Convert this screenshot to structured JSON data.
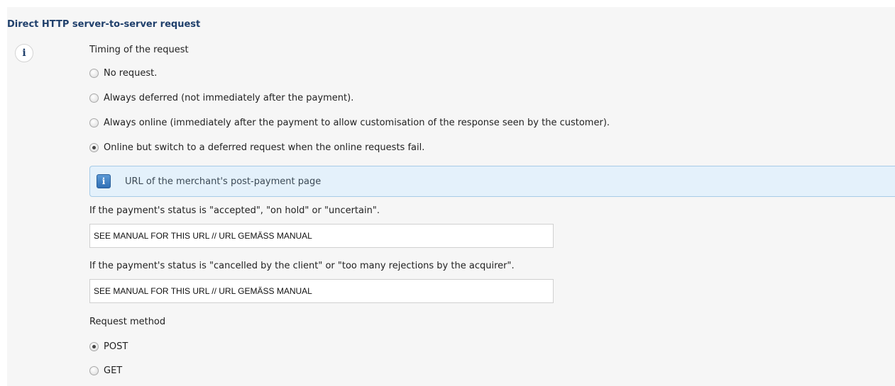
{
  "section": {
    "title": "Direct HTTP server-to-server request",
    "info_icon": "info-icon"
  },
  "timing": {
    "label": "Timing of the request",
    "options": [
      {
        "label": "No request.",
        "checked": false
      },
      {
        "label": "Always deferred (not immediately after the payment).",
        "checked": false
      },
      {
        "label": "Always online (immediately after the payment to allow customisation of the response seen by the customer).",
        "checked": false
      },
      {
        "label": "Online but switch to a deferred request when the online requests fail.",
        "checked": true
      }
    ]
  },
  "info_bar": {
    "icon": "info-icon",
    "text": "URL of the merchant's post-payment page"
  },
  "url_accepted": {
    "label": "If the payment's status is \"accepted\", \"on hold\" or \"uncertain\".",
    "value": "SEE MANUAL FOR THIS URL // URL GEMÄSS MANUAL"
  },
  "url_cancelled": {
    "label": "If the payment's status is \"cancelled by the client\" or \"too many rejections by the acquirer\".",
    "value": "SEE MANUAL FOR THIS URL // URL GEMÄSS MANUAL"
  },
  "method": {
    "label": "Request method",
    "options": [
      {
        "label": "POST",
        "checked": true
      },
      {
        "label": "GET",
        "checked": false
      }
    ]
  }
}
